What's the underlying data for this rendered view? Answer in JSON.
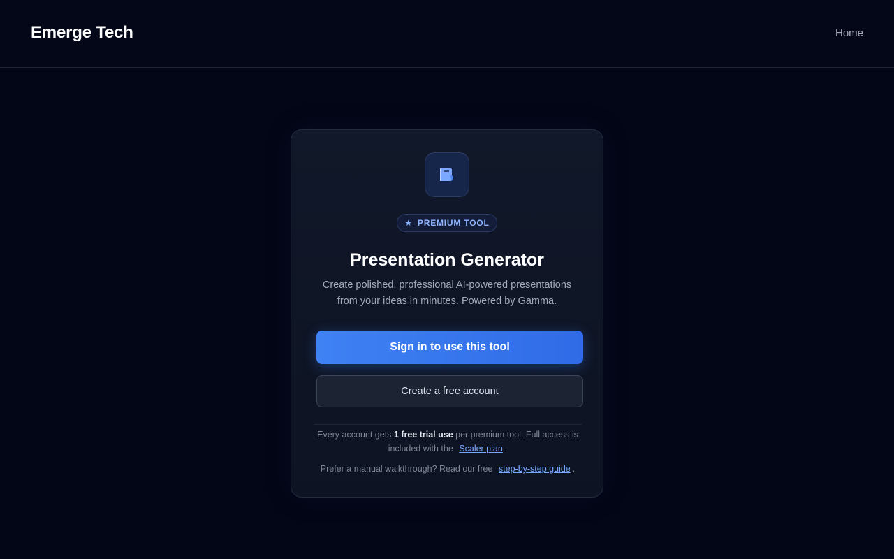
{
  "header": {
    "brand": "Emerge Tech",
    "nav_home": "Home"
  },
  "card": {
    "icon": "presentation-icon",
    "badge": {
      "icon": "star-icon",
      "label": "PREMIUM TOOL"
    },
    "title": "Presentation Generator",
    "subtitle": "Create polished, professional AI-powered presentations from your ideas in minutes. Powered by Gamma.",
    "primary_button": "Sign in to use this tool",
    "secondary_button": "Create a free account",
    "trial_note": {
      "prefix": "Every account gets ",
      "highlight": "1 free trial use",
      "middle": " per premium tool. Full access is included with the ",
      "link": "Scaler plan",
      "suffix": "."
    },
    "guide_note": {
      "prefix": "Prefer a manual walkthrough? Read our free ",
      "link": "step-by-step guide",
      "suffix": "."
    }
  },
  "colors": {
    "background": "#030616",
    "accent": "#3f82f4",
    "link": "#7aa7ff",
    "badge_text": "#8db4ff"
  }
}
